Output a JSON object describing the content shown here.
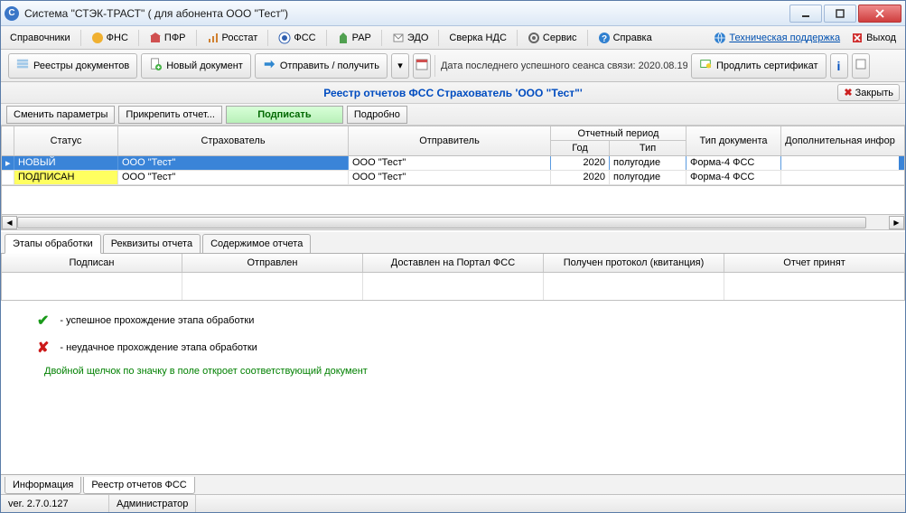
{
  "window": {
    "title": "Система \"СТЭК-ТРАСТ\"  ( для абонента ООО \"Тест\")"
  },
  "menu": {
    "spravochniki": "Справочники",
    "fns": "ФНС",
    "pfr": "ПФР",
    "rosstat": "Росстат",
    "fss": "ФСС",
    "rar": "РАР",
    "edo": "ЭДО",
    "sverka_nds": "Сверка НДС",
    "servis": "Сервис",
    "spravka": "Справка",
    "tech": "Техническая поддержка",
    "exit": "Выход"
  },
  "toolbar": {
    "registry": "Реестры документов",
    "new_doc": "Новый документ",
    "send_receive": "Отправить / получить",
    "last_session": "Дата последнего успешного сеанса связи: 2020.08.19",
    "prolong": "Продлить сертификат"
  },
  "header": {
    "title": "Реестр отчетов ФСС  Страхователь 'ООО \"Тест\"'",
    "close": "Закрыть"
  },
  "actions": {
    "change_params": "Сменить параметры",
    "attach": "Прикрепить отчет...",
    "sign": "Подписать",
    "details": "Подробно"
  },
  "grid": {
    "headers": {
      "status": "Статус",
      "strahovatel": "Страхователь",
      "otpravitel": "Отправитель",
      "period": "Отчетный период",
      "god": "Год",
      "tip": "Тип",
      "tip_doc": "Тип документа",
      "dop": "Дополнительная инфор"
    },
    "rows": [
      {
        "status": "НОВЫЙ",
        "strah": "ООО \"Тест\"",
        "otpr": "ООО \"Тест\"",
        "god": "2020",
        "tip": "полугодие",
        "doc": "Форма-4 ФСС",
        "selected": true
      },
      {
        "status": "ПОДПИСАН",
        "strah": "ООО \"Тест\"",
        "otpr": "ООО \"Тест\"",
        "god": "2020",
        "tip": "полугодие",
        "doc": "Форма-4 ФСС",
        "selected": false
      }
    ]
  },
  "tabs": {
    "etapy": "Этапы обработки",
    "rekvizity": "Реквизиты отчета",
    "soderzhimoe": "Содержимое отчета"
  },
  "stages": {
    "podpisan": "Подписан",
    "otpravlen": "Отправлен",
    "dostavlen": "Доставлен на Портал ФСС",
    "protokol": "Получен протокол (квитанция)",
    "prinyat": "Отчет принят"
  },
  "legend": {
    "ok": "-  успешное прохождение этапа обработки",
    "fail": "-  неудачное прохождение этапа обработки",
    "hint": "Двойной щелчок по значку в поле откроет соответствующий документ"
  },
  "bottom_tabs": {
    "info": "Информация",
    "registry": "Реестр отчетов ФСС"
  },
  "status": {
    "version": "ver. 2.7.0.127",
    "user": "Администратор"
  },
  "colors": {
    "accent": "#004cc0",
    "selection": "#3a84d8",
    "highlight": "#ffff60",
    "success": "#1a9a1a",
    "error": "#cc1a1a"
  }
}
